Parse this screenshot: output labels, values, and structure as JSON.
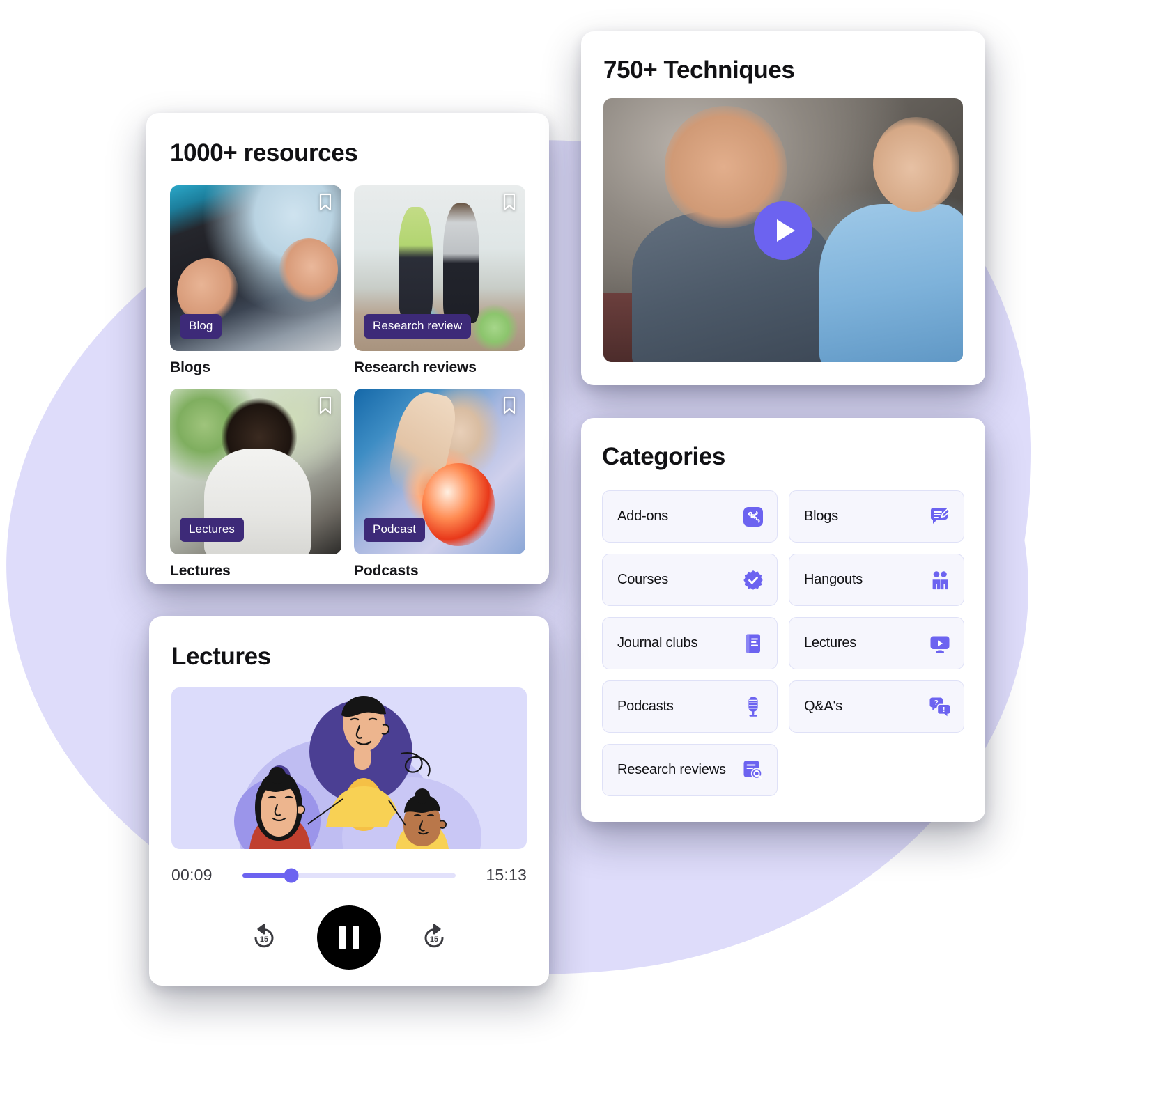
{
  "theme": {
    "accent": "#6c63f0",
    "blob": "#dedcfa",
    "chip_bg": "#3d2a78",
    "tile_bg": "#f6f6fd",
    "tile_border": "#dfe1f7",
    "text": "#111114"
  },
  "resources_card": {
    "title": "1000+ resources",
    "items": [
      {
        "chip": "Blog",
        "label": "Blogs",
        "bookmark_icon": "bookmark-icon",
        "photo": "ph-shoe"
      },
      {
        "chip": "Research review",
        "label": "Research reviews",
        "bookmark_icon": "bookmark-icon",
        "photo": "ph-gym"
      },
      {
        "chip": "Lectures",
        "label": "Lectures",
        "bookmark_icon": "bookmark-icon",
        "photo": "ph-man"
      },
      {
        "chip": "Podcast",
        "label": "Podcasts",
        "bookmark_icon": "bookmark-icon",
        "photo": "ph-anat"
      }
    ]
  },
  "techniques_card": {
    "title": "750+ Techniques",
    "play_icon": "play-icon"
  },
  "categories_card": {
    "title": "Categories",
    "items": [
      {
        "label": "Add-ons",
        "icon": "puzzle-icon"
      },
      {
        "label": "Blogs",
        "icon": "blog-edit-icon"
      },
      {
        "label": "Courses",
        "icon": "check-badge-icon"
      },
      {
        "label": "Hangouts",
        "icon": "people-icon"
      },
      {
        "label": "Journal clubs",
        "icon": "book-icon"
      },
      {
        "label": "Lectures",
        "icon": "monitor-play-icon"
      },
      {
        "label": "Podcasts",
        "icon": "microphone-icon"
      },
      {
        "label": "Q&A's",
        "icon": "question-chat-icon"
      },
      {
        "label": "Research reviews",
        "icon": "document-search-icon"
      }
    ]
  },
  "lectures_card": {
    "title": "Lectures",
    "player": {
      "current_time": "00:09",
      "total_time": "15:13",
      "progress_percent": 23,
      "rewind_label": "15",
      "forward_label": "15",
      "rewind_icon": "rewind-15-icon",
      "forward_icon": "forward-15-icon",
      "pause_icon": "pause-icon"
    }
  }
}
